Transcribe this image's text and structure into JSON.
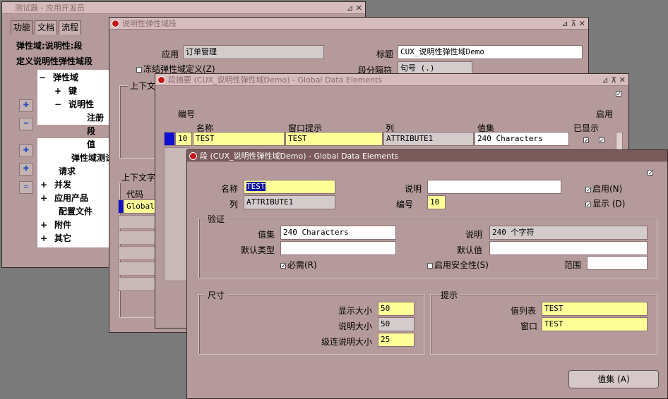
{
  "window1": {
    "title": "测试器 - 应用开发员",
    "tabs": [
      "功能",
      "文档",
      "流程"
    ],
    "header_label": "弹性域:说明性:段",
    "subheader": "定义说明性弹性域段",
    "tree": [
      {
        "sign": "−",
        "label": "弹性域"
      },
      {
        "sign": "+",
        "label": "键"
      },
      {
        "sign": "−",
        "label": "说明性"
      },
      {
        "sign": "",
        "label": "注册"
      },
      {
        "sign": "",
        "label": "段"
      },
      {
        "sign": "",
        "label": "值"
      },
      {
        "sign": "",
        "label": "弹性域测试"
      },
      {
        "sign": "",
        "label": "请求"
      },
      {
        "sign": "+",
        "label": "并发"
      },
      {
        "sign": "+",
        "label": "应用产品"
      },
      {
        "sign": "",
        "label": "配置文件"
      },
      {
        "sign": "+",
        "label": "附件"
      },
      {
        "sign": "+",
        "label": "其它"
      }
    ]
  },
  "window2": {
    "title": "说明性弹性域段",
    "app_label": "应用",
    "app_value": "订单管理",
    "title_label": "标题",
    "title_value": "CUX_说明性弹性域Demo",
    "freeze_label": "冻结弹性域定义(Z)",
    "sep_label": "段分隔符",
    "sep_value": "句号 (.)",
    "context_group": "上下文",
    "context_group2": "上下文字",
    "code_label": "代码",
    "code_value": "Global"
  },
  "window3": {
    "title": "段摘要 (CUX_说明性弹性域Demo) - Global Data Elements",
    "headers": {
      "num": "编号",
      "name": "名称",
      "prompt": "窗口提示",
      "col": "列",
      "valueset": "值集",
      "shown": "已显示",
      "enabled": "启用"
    },
    "row": {
      "num": "10",
      "name": "TEST",
      "prompt": "TEST",
      "col": "ATTRIBUTE1",
      "valueset": "240 Characters"
    }
  },
  "window4": {
    "title": "段 (CUX_说明性弹性域Demo) - Global Data Elements",
    "name_label": "名称",
    "name_value": "TEST",
    "col_label": "列",
    "col_value": "ATTRIBUTE1",
    "desc_label": "说明",
    "desc_value": "",
    "num_label": "编号",
    "num_value": "10",
    "enabled_label": "启用(N)",
    "displayed_label": "显示 (D)",
    "validation": {
      "title": "验证",
      "valueset_label": "值集",
      "valueset_value": "240 Characters",
      "desc_label": "说明",
      "desc_value": "240 个字符",
      "default_type_label": "默认类型",
      "default_type_value": "",
      "default_value_label": "默认值",
      "default_value_value": "",
      "required_label": "必需(R)",
      "security_label": "启用安全性(S)",
      "range_label": "范围",
      "range_value": ""
    },
    "size": {
      "title": "尺寸",
      "display_label": "显示大小",
      "display_value": "50",
      "desc_label": "说明大小",
      "desc_value": "50",
      "concat_label": "级连说明大小",
      "concat_value": "25"
    },
    "prompt": {
      "title": "提示",
      "list_label": "值列表",
      "list_value": "TEST",
      "window_label": "窗口",
      "window_value": "TEST"
    },
    "valueset_button": "值集 (A)"
  }
}
